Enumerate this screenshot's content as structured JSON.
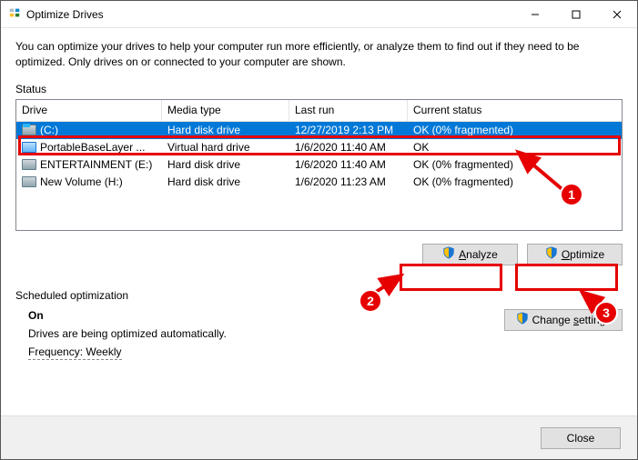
{
  "window": {
    "title": "Optimize Drives"
  },
  "description": "You can optimize your drives to help your computer run more efficiently, or analyze them to find out if they need to be optimized. Only drives on or connected to your computer are shown.",
  "status_label": "Status",
  "columns": {
    "drive": "Drive",
    "media": "Media type",
    "last_run": "Last run",
    "status": "Current status"
  },
  "drives": [
    {
      "name": "(C:)",
      "icon": "win",
      "media": "Hard disk drive",
      "last_run": "12/27/2019 2:13 PM",
      "status": "OK (0% fragmented)",
      "selected": true
    },
    {
      "name": "PortableBaseLayer ...",
      "icon": "vh",
      "media": "Virtual hard drive",
      "last_run": "1/6/2020 11:40 AM",
      "status": "OK",
      "selected": false
    },
    {
      "name": "ENTERTAINMENT (E:)",
      "icon": "hd",
      "media": "Hard disk drive",
      "last_run": "1/6/2020 11:40 AM",
      "status": "OK (0% fragmented)",
      "selected": false
    },
    {
      "name": "New Volume (H:)",
      "icon": "hd",
      "media": "Hard disk drive",
      "last_run": "1/6/2020 11:23 AM",
      "status": "OK (0% fragmented)",
      "selected": false
    }
  ],
  "buttons": {
    "analyze": "Analyze",
    "optimize": "Optimize",
    "change_settings": "Change settings",
    "close": "Close"
  },
  "scheduled": {
    "label": "Scheduled optimization",
    "state": "On",
    "message": "Drives are being optimized automatically.",
    "frequency_label": "Frequency: Weekly"
  },
  "annotations": {
    "b1": "1",
    "b2": "2",
    "b3": "3"
  }
}
